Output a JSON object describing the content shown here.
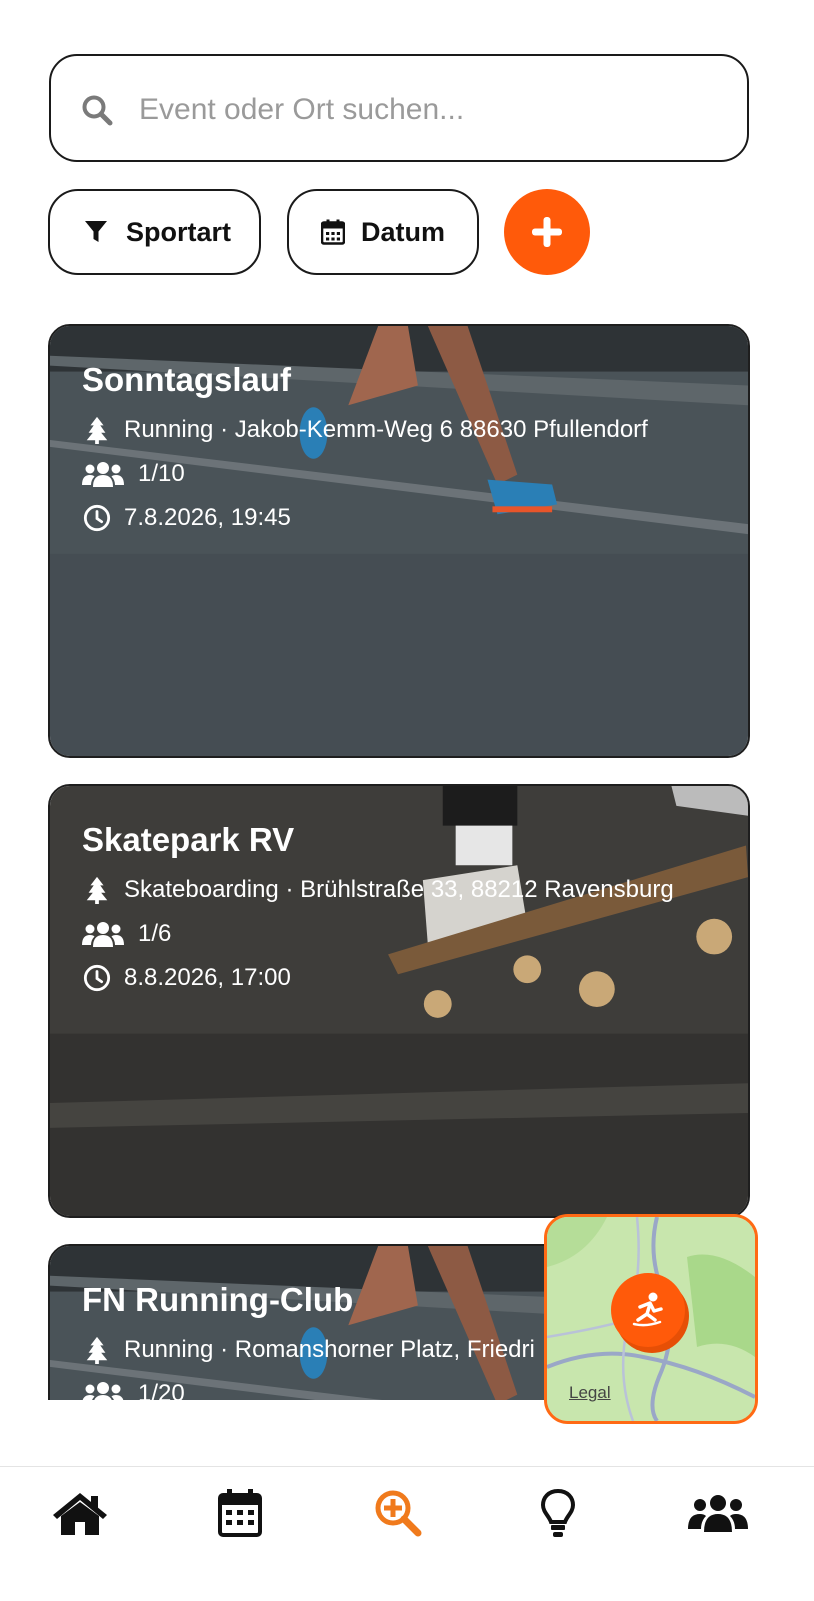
{
  "search": {
    "placeholder": "Event oder Ort suchen...",
    "value": ""
  },
  "filters": {
    "sport_label": "Sportart",
    "date_label": "Datum"
  },
  "add_button": {
    "icon": "plus-icon"
  },
  "accent_color": "#ff5a0a",
  "events": [
    {
      "title": "Sonntagslauf",
      "location": "Running · Jakob-Kemm-Weg 6 88630 Pfullendorf",
      "participants": "1/10",
      "datetime": "7.8.2026, 19:45"
    },
    {
      "title": "Skatepark RV",
      "location": "Skateboarding · Brühlstraße 33, 88212 Ravensburg",
      "participants": "1/6",
      "datetime": "8.8.2026, 17:00"
    },
    {
      "title": "FN Running-Club",
      "location": "Running · Romanshorner Platz, Friedri",
      "participants": "1/20",
      "datetime": ""
    }
  ],
  "map": {
    "legal_label": "Legal",
    "marker_icon": "skater-icon"
  },
  "tabs": [
    "home-icon",
    "calendar-icon",
    "search-plus-icon",
    "lightbulb-icon",
    "group-icon"
  ]
}
